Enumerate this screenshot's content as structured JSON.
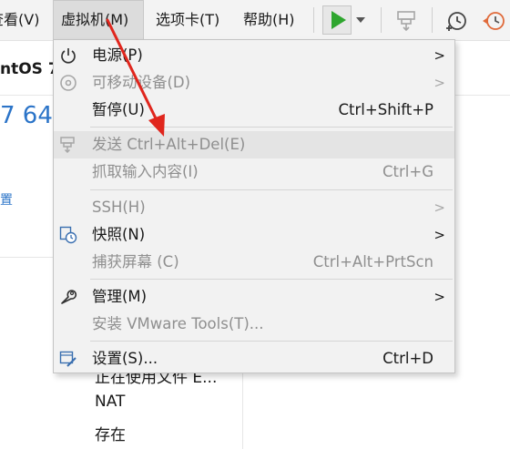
{
  "menubar": {
    "items": [
      {
        "label": "查看(V)"
      },
      {
        "label": "虚拟机(M)"
      },
      {
        "label": "选项卡(T)"
      },
      {
        "label": "帮助(H)"
      }
    ],
    "toolbar": {
      "play_icon": "play-icon",
      "play_color": "#2ea62e",
      "send_keys_icon": "send-keys-icon",
      "snapshot_icon": "snapshot-icon",
      "revert_snapshot_icon": "revert-snapshot-icon"
    }
  },
  "background": {
    "vm_title": "ntOS 7",
    "big_text": "7 64",
    "link_text": "置",
    "rows": [
      "正在使用文件 E...",
      "NAT",
      "存在"
    ]
  },
  "vm_menu": {
    "items": [
      {
        "label": "电源(P)",
        "shortcut": "",
        "icon": "power-icon",
        "submenu": true,
        "disabled": false
      },
      {
        "label": "可移动设备(D)",
        "shortcut": "",
        "icon": "disc-icon",
        "submenu": true,
        "disabled": true
      },
      {
        "label": "暂停(U)",
        "shortcut": "Ctrl+Shift+P",
        "icon": "",
        "submenu": false,
        "disabled": false
      },
      {
        "label": "发送 Ctrl+Alt+Del(E)",
        "shortcut": "",
        "icon": "send-keys-icon",
        "submenu": false,
        "disabled": true,
        "highlighted": true
      },
      {
        "label": "抓取输入内容(I)",
        "shortcut": "Ctrl+G",
        "icon": "",
        "submenu": false,
        "disabled": true
      },
      {
        "label": "SSH(H)",
        "shortcut": "",
        "icon": "",
        "submenu": true,
        "disabled": true
      },
      {
        "label": "快照(N)",
        "shortcut": "",
        "icon": "snapshot-icon",
        "submenu": true,
        "disabled": false
      },
      {
        "label": "捕获屏幕 (C)",
        "shortcut": "Ctrl+Alt+PrtScn",
        "icon": "",
        "submenu": false,
        "disabled": true
      },
      {
        "label": "管理(M)",
        "shortcut": "",
        "icon": "wrench-icon",
        "submenu": true,
        "disabled": false
      },
      {
        "label": "安装 VMware Tools(T)...",
        "shortcut": "",
        "icon": "",
        "submenu": false,
        "disabled": true
      },
      {
        "label": "设置(S)...",
        "shortcut": "Ctrl+D",
        "icon": "settings-icon",
        "submenu": false,
        "disabled": false
      }
    ],
    "submenu_arrow": ">"
  },
  "annotation": {
    "color": "#e0261d"
  }
}
